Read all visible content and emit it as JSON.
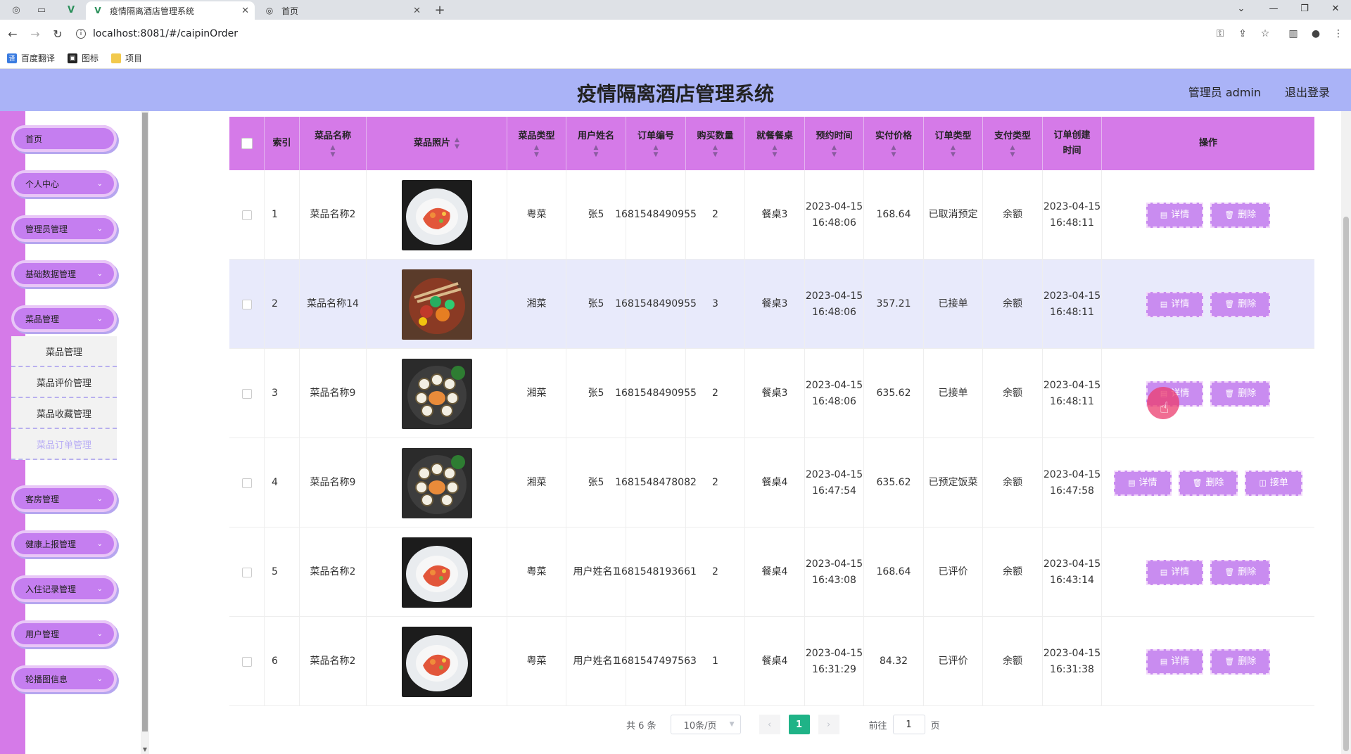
{
  "browser": {
    "tabs": [
      {
        "title": "疫情隔离酒店管理系统",
        "active": true
      },
      {
        "title": "首页",
        "active": false
      }
    ],
    "url": "localhost:8081/#/caipinOrder",
    "bookmarks": [
      "百度翻译",
      "图标",
      "项目"
    ]
  },
  "header": {
    "title": "疫情隔离酒店管理系统",
    "admin_label": "管理员 admin",
    "logout": "退出登录"
  },
  "sidebar": {
    "items": [
      {
        "label": "首页",
        "chevron": false
      },
      {
        "label": "个人中心",
        "chevron": true
      },
      {
        "label": "管理员管理",
        "chevron": true
      },
      {
        "label": "基础数据管理",
        "chevron": true
      },
      {
        "label": "菜品管理",
        "chevron": true
      },
      {
        "label": "客房管理",
        "chevron": true
      },
      {
        "label": "健康上报管理",
        "chevron": true
      },
      {
        "label": "入住记录管理",
        "chevron": true
      },
      {
        "label": "用户管理",
        "chevron": true
      },
      {
        "label": "轮播图信息",
        "chevron": true
      }
    ],
    "submenu": [
      "菜品管理",
      "菜品评价管理",
      "菜品收藏管理",
      "菜品订单管理"
    ]
  },
  "table": {
    "headers": {
      "index": "索引",
      "name": "菜品名称",
      "photo": "菜品照片",
      "type": "菜品类型",
      "user": "用户姓名",
      "order_no": "订单编号",
      "qty": "购买数量",
      "table": "就餐餐桌",
      "reserve": "预约时间",
      "price": "实付价格",
      "order_type": "订单类型",
      "pay": "支付类型",
      "created": "订单创建时间",
      "ops": "操作"
    },
    "buttons": {
      "detail": "详情",
      "delete": "删除",
      "accept": "接单"
    },
    "rows": [
      {
        "index": "1",
        "name": "菜品名称2",
        "type": "粤菜",
        "user": "张5",
        "order_no": "1681548490955",
        "qty": "2",
        "table": "餐桌3",
        "reserve": "2023-04-15 16:48:06",
        "price": "168.64",
        "order_type": "已取消预定",
        "pay": "余额",
        "created": "2023-04-15 16:48:11",
        "photo": "salmon-dish"
      },
      {
        "index": "2",
        "name": "菜品名称14",
        "type": "湘菜",
        "user": "张5",
        "order_no": "1681548490955",
        "qty": "3",
        "table": "餐桌3",
        "reserve": "2023-04-15 16:48:06",
        "price": "357.21",
        "order_type": "已接单",
        "pay": "余额",
        "created": "2023-04-15 16:48:11",
        "photo": "stirfry-dish"
      },
      {
        "index": "3",
        "name": "菜品名称9",
        "type": "湘菜",
        "user": "张5",
        "order_no": "1681548490955",
        "qty": "2",
        "table": "餐桌3",
        "reserve": "2023-04-15 16:48:06",
        "price": "635.62",
        "order_type": "已接单",
        "pay": "余额",
        "created": "2023-04-15 16:48:11",
        "photo": "sushi-dish"
      },
      {
        "index": "4",
        "name": "菜品名称9",
        "type": "湘菜",
        "user": "张5",
        "order_no": "1681548478082",
        "qty": "2",
        "table": "餐桌4",
        "reserve": "2023-04-15 16:47:54",
        "price": "635.62",
        "order_type": "已预定饭菜",
        "pay": "余额",
        "created": "2023-04-15 16:47:58",
        "photo": "sushi-dish",
        "accept": true
      },
      {
        "index": "5",
        "name": "菜品名称2",
        "type": "粤菜",
        "user": "用户姓名1",
        "order_no": "1681548193661",
        "qty": "2",
        "table": "餐桌4",
        "reserve": "2023-04-15 16:43:08",
        "price": "168.64",
        "order_type": "已评价",
        "pay": "余额",
        "created": "2023-04-15 16:43:14",
        "photo": "salmon-dish"
      },
      {
        "index": "6",
        "name": "菜品名称2",
        "type": "粤菜",
        "user": "用户姓名1",
        "order_no": "1681547497563",
        "qty": "1",
        "table": "餐桌4",
        "reserve": "2023-04-15 16:31:29",
        "price": "84.32",
        "order_type": "已评价",
        "pay": "余额",
        "created": "2023-04-15 16:31:38",
        "photo": "salmon-dish"
      }
    ]
  },
  "pagination": {
    "total": "共 6 条",
    "page_size": "10条/页",
    "current": "1",
    "goto_label": "前往",
    "goto_value": "1",
    "page_suffix": "页"
  },
  "colors": {
    "header": "#aab3f7",
    "sidebar": "#d57ae8",
    "table_head": "#d57ae8",
    "button": "#c98cf0",
    "pager_active": "#1fb387"
  }
}
